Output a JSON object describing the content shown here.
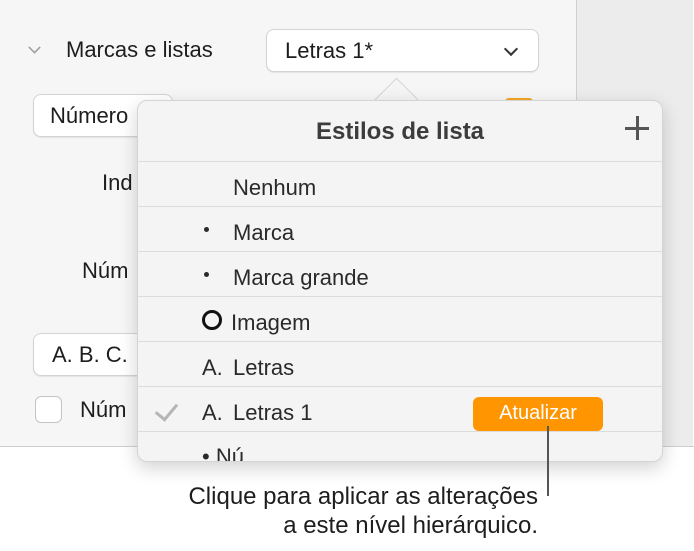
{
  "sidebar": {
    "section_title": "Marcas e listas",
    "style_popup_value": "Letras 1*",
    "type_popup_value": "Número",
    "indent_label": "Ind",
    "number_label": "Núm",
    "number_format_value": "A. B. C.",
    "number_check_label": "Núm"
  },
  "popover": {
    "title": "Estilos de lista",
    "items": [
      {
        "label": "Nenhum"
      },
      {
        "label": "Marca"
      },
      {
        "label": "Marca grande"
      },
      {
        "label": "Imagem"
      },
      {
        "prefix": "A.",
        "label": "Letras"
      },
      {
        "prefix": "A.",
        "label": "Letras 1",
        "selected": true,
        "action": "Atualizar"
      },
      {
        "label": "• Nú"
      }
    ]
  },
  "callout": {
    "line1": "Clique para aplicar as alterações",
    "line2": "a este nível hierárquico."
  },
  "colors": {
    "accent": "#ff9500",
    "popover_bg": "#f4f4f4"
  }
}
